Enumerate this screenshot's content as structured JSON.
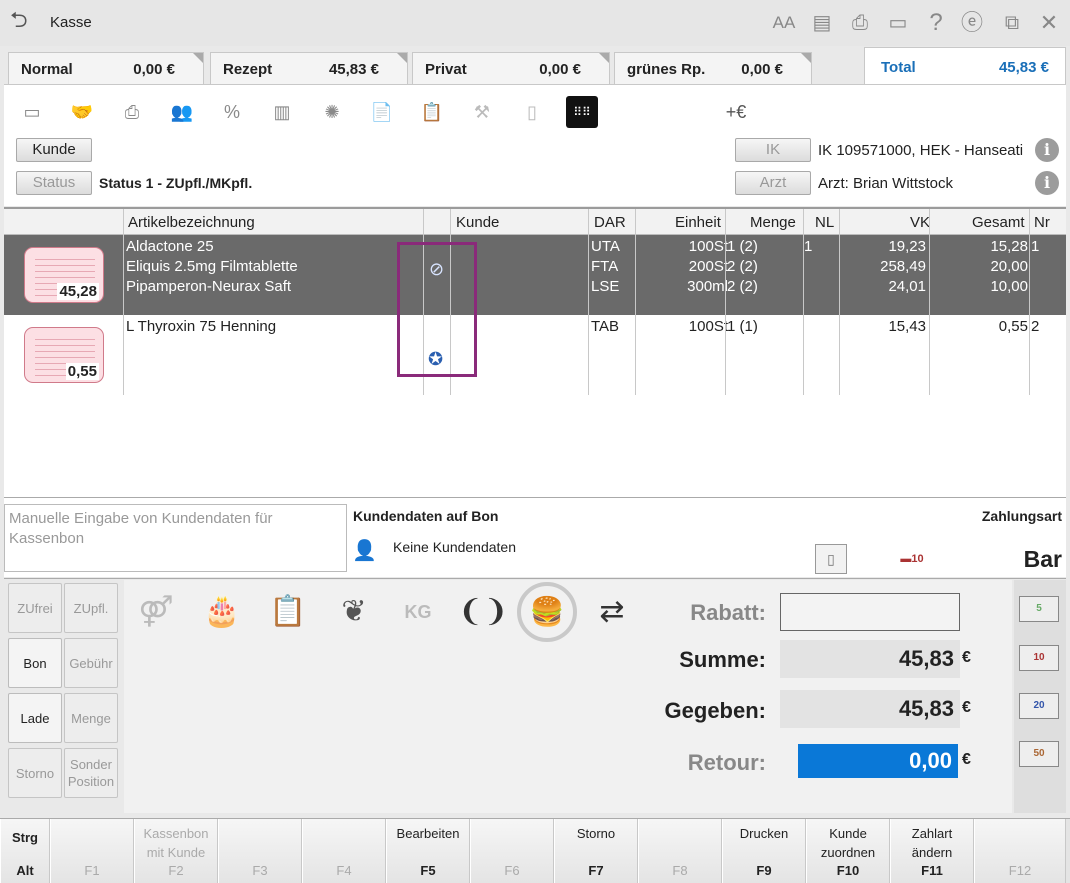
{
  "window": {
    "title": "Kasse"
  },
  "toolbar_icons": [
    "font-size-icon",
    "document-icon",
    "printer-icon",
    "monitor-icon",
    "help-icon",
    "e-icon",
    "exit-icon",
    "close-icon"
  ],
  "tabs": [
    {
      "label": "Normal",
      "value": "0,00 €"
    },
    {
      "label": "Rezept",
      "value": "45,83 €"
    },
    {
      "label": "Privat",
      "value": "0,00 €"
    },
    {
      "label": "grünes Rp.",
      "value": "0,00 €"
    }
  ],
  "total": {
    "label": "Total",
    "value": "45,83 €"
  },
  "header": {
    "customer_button": "Kunde",
    "status_button": "Status",
    "status_text": "Status 1 - ZUpfl./MKpfl.",
    "ik_button": "IK",
    "ik_text": "IK 109571000, HEK - Hanseati",
    "arzt_button": "Arzt",
    "arzt_text": "Arzt: Brian Wittstock"
  },
  "table": {
    "columns": [
      "Artikelbezeichnung",
      "Kunde",
      "DAR",
      "Einheit",
      "Menge",
      "NL",
      "VK",
      "Gesamt",
      "Nr"
    ],
    "groups": [
      {
        "receipt_amount": "45,28",
        "nr": "1",
        "items": [
          {
            "name": "Aldactone 25",
            "dar": "UTA",
            "einheit": "100St",
            "menge": "1 (2)",
            "nl": "1",
            "vk": "19,23",
            "gesamt": "15,28"
          },
          {
            "name": "Eliquis 2.5mg Filmtablette",
            "dar": "FTA",
            "einheit": "200St",
            "menge": "2 (2)",
            "nl": "",
            "vk": "258,49",
            "gesamt": "20,00"
          },
          {
            "name": "Pipamperon-Neurax Saft",
            "dar": "LSE",
            "einheit": "300ml",
            "menge": "2 (2)",
            "nl": "",
            "vk": "24,01",
            "gesamt": "10,00"
          }
        ]
      },
      {
        "receipt_amount": "0,55",
        "nr": "2",
        "items": [
          {
            "name": "L Thyroxin 75 Henning",
            "dar": "TAB",
            "einheit": "100St",
            "menge": "1 (1)",
            "nl": "",
            "vk": "15,43",
            "gesamt": "0,55"
          }
        ]
      }
    ]
  },
  "customer_data": {
    "placeholder": "Manuelle Eingabe von Kundendaten für Kassenbon",
    "title": "Kundendaten auf Bon",
    "value": "Keine Kundendaten",
    "payment_label": "Zahlungsart",
    "payment_value": "Bar"
  },
  "side_keys": [
    {
      "label": "ZUfrei",
      "enabled": false
    },
    {
      "label": "ZUpfl.",
      "enabled": false
    },
    {
      "label": "Bon",
      "enabled": true
    },
    {
      "label": "Gebühr",
      "enabled": false
    },
    {
      "label": "Lade",
      "enabled": true
    },
    {
      "label": "Menge",
      "enabled": false
    },
    {
      "label": "Storno",
      "enabled": false
    },
    {
      "label": "Sonder Position",
      "enabled": false
    }
  ],
  "payment": {
    "rabatt_label": "Rabatt:",
    "rabatt_value": "",
    "summe_label": "Summe:",
    "summe_value": "45,83",
    "gegeben_label": "Gegeben:",
    "gegeben_value": "45,83",
    "retour_label": "Retour:",
    "retour_value": "0,00",
    "currency": "€"
  },
  "bills": [
    "5",
    "10",
    "20",
    "50"
  ],
  "function_keys": [
    {
      "top": "Strg",
      "key": "Alt",
      "enabled": true
    },
    {
      "top": "",
      "key": "F1",
      "enabled": false
    },
    {
      "top": "Kassenbon mit Kunde",
      "key": "F2",
      "enabled": false
    },
    {
      "top": "",
      "key": "F3",
      "enabled": false
    },
    {
      "top": "",
      "key": "F4",
      "enabled": false
    },
    {
      "top": "Bearbeiten",
      "key": "F5",
      "enabled": true
    },
    {
      "top": "",
      "key": "F6",
      "enabled": false
    },
    {
      "top": "Storno",
      "key": "F7",
      "enabled": true
    },
    {
      "top": "",
      "key": "F8",
      "enabled": false
    },
    {
      "top": "Drucken",
      "key": "F9",
      "enabled": true
    },
    {
      "top": "Kunde zuordnen",
      "key": "F10",
      "enabled": true
    },
    {
      "top": "Zahlart ändern",
      "key": "F11",
      "enabled": true
    },
    {
      "top": "",
      "key": "F12",
      "enabled": false
    }
  ],
  "colors": {
    "accent": "#1a6fb8",
    "row_selected": "#6a6a6a",
    "retour_bg": "#0a78d7",
    "highlight_box": "#8a2a7a"
  }
}
